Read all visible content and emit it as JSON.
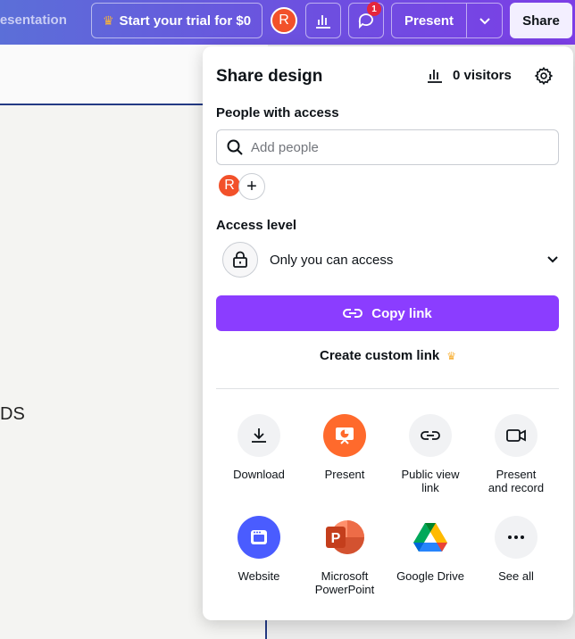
{
  "topbar": {
    "doc_title": "resentation",
    "trial_label": "Start your trial for $0",
    "avatar_initial": "R",
    "comment_badge": "1",
    "present_label": "Present",
    "share_label": "Share"
  },
  "canvas": {
    "text": "DS"
  },
  "panel": {
    "title": "Share design",
    "visitors": "0 visitors",
    "people_label": "People with access",
    "search_placeholder": "Add people",
    "member_initial": "R",
    "add_member_glyph": "+",
    "access_level_label": "Access level",
    "access_value": "Only you can access",
    "copy_link_label": "Copy link",
    "custom_link_label": "Create custom link",
    "options": [
      {
        "label": "Download",
        "icon": "download-icon"
      },
      {
        "label": "Present",
        "icon": "present-icon"
      },
      {
        "label": "Public view link",
        "icon": "link-icon"
      },
      {
        "label": "Present and record",
        "icon": "video-camera-icon"
      },
      {
        "label": "Website",
        "icon": "website-icon"
      },
      {
        "label": "Microsoft PowerPoint",
        "icon": "powerpoint-icon"
      },
      {
        "label": "Google Drive",
        "icon": "google-drive-icon"
      },
      {
        "label": "See all",
        "icon": "more-icon"
      }
    ]
  },
  "colors": {
    "accent": "#8b3dff",
    "avatar": "#f2512a",
    "badge": "#e5263d",
    "present_orange": "#ff6a2c",
    "website_blue": "#4a5cff"
  }
}
